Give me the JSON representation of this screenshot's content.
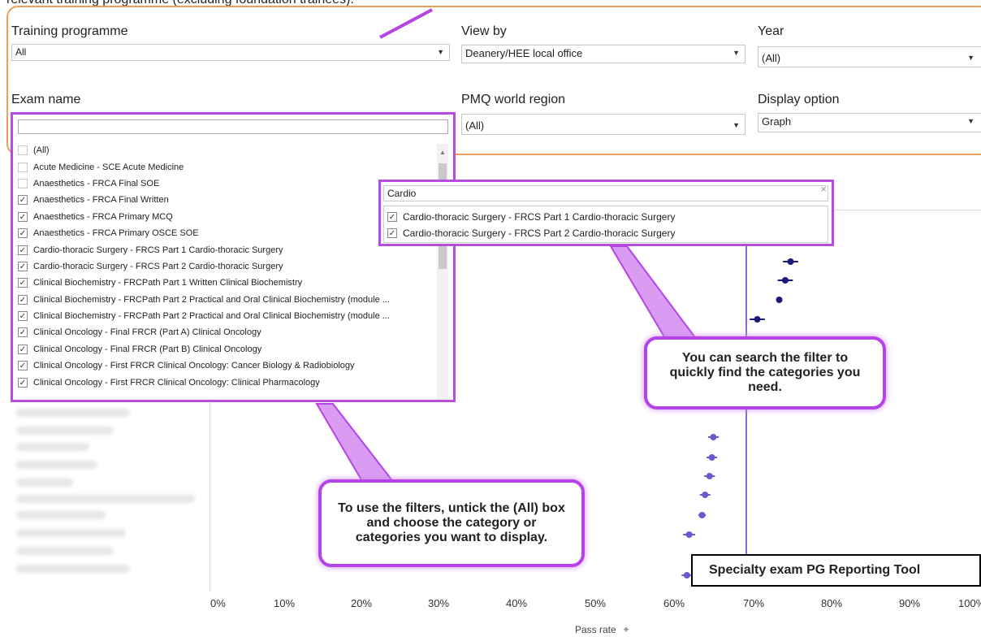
{
  "page": {
    "cut_title": "relevant training programme (excluding foundation trainees)."
  },
  "filters": {
    "training_programme": {
      "label": "Training programme",
      "value": "All"
    },
    "view_by": {
      "label": "View by",
      "value": "Deanery/HEE local office"
    },
    "year": {
      "label": "Year",
      "value": "(All)"
    },
    "exam_name": {
      "label": "Exam name"
    },
    "pmq_region": {
      "label": "PMQ world region",
      "value": "(All)"
    },
    "display_option": {
      "label": "Display option",
      "value": "Graph"
    }
  },
  "exam_dropdown": {
    "options": [
      {
        "label": "(All)",
        "checked": false
      },
      {
        "label": "Acute Medicine - SCE Acute Medicine",
        "checked": false
      },
      {
        "label": "Anaesthetics - FRCA Final SOE",
        "checked": false
      },
      {
        "label": "Anaesthetics - FRCA Final Written",
        "checked": true
      },
      {
        "label": "Anaesthetics - FRCA Primary MCQ",
        "checked": true
      },
      {
        "label": "Anaesthetics - FRCA Primary OSCE SOE",
        "checked": true
      },
      {
        "label": "Cardio-thoracic Surgery - FRCS Part 1 Cardio-thoracic Surgery",
        "checked": true
      },
      {
        "label": "Cardio-thoracic Surgery - FRCS Part 2 Cardio-thoracic Surgery",
        "checked": true
      },
      {
        "label": "Clinical Biochemistry - FRCPath Part 1 Written Clinical Biochemistry",
        "checked": true
      },
      {
        "label": "Clinical Biochemistry - FRCPath Part 2 Practical and Oral Clinical Biochemistry (module ...",
        "checked": true
      },
      {
        "label": "Clinical Biochemistry - FRCPath Part 2 Practical and Oral Clinical Biochemistry (module ...",
        "checked": true
      },
      {
        "label": "Clinical Oncology - Final FRCR (Part A) Clinical Oncology",
        "checked": true
      },
      {
        "label": "Clinical Oncology - Final FRCR (Part B) Clinical Oncology",
        "checked": true
      },
      {
        "label": "Clinical Oncology - First FRCR Clinical Oncology: Cancer Biology & Radiobiology",
        "checked": true
      },
      {
        "label": "Clinical Oncology - First FRCR Clinical Oncology: Clinical Pharmacology",
        "checked": true
      }
    ]
  },
  "cardio_filter": {
    "search_value": "Cardio",
    "close_icon": "×",
    "options": [
      {
        "label": "Cardio-thoracic Surgery - FRCS Part 1 Cardio-thoracic Surgery",
        "checked": true
      },
      {
        "label": "Cardio-thoracic Surgery - FRCS Part 2 Cardio-thoracic Surgery",
        "checked": true
      }
    ]
  },
  "callouts": {
    "search_tip": "You can search the filter to quickly find the categories you need.",
    "filter_tip": "To use the filters, untick the (All) box and choose the category or categories you want to display."
  },
  "brand": "Specialty exam PG Reporting Tool",
  "chart_data": {
    "type": "scatter",
    "xlabel": "Pass rate",
    "xlim": [
      0,
      100
    ],
    "x_ticks": [
      "0%",
      "10%",
      "20%",
      "30%",
      "40%",
      "50%",
      "60%",
      "70%",
      "80%",
      "90%",
      "100%"
    ],
    "reference_line_x": 66,
    "colors": {
      "dark": "#1a1a7a",
      "light": "#6a5acd",
      "ref": "#8d6bd1"
    },
    "series": [
      {
        "values": [
          {
            "x": 75.7,
            "err": 1.0
          },
          {
            "x": 75.0,
            "err": 1.0
          },
          {
            "x": 74.2,
            "err": 0.3
          },
          {
            "x": 71.3,
            "err": 1.0
          }
        ]
      },
      {
        "values": [
          {
            "x": 65.5,
            "err": 0.7
          },
          {
            "x": 65.3,
            "err": 0.7
          },
          {
            "x": 65.0,
            "err": 0.7
          },
          {
            "x": 64.4,
            "err": 0.7
          },
          {
            "x": 64.0,
            "err": 0.5
          },
          {
            "x": 62.3,
            "err": 0.8
          },
          {
            "x": 62.0,
            "err": 0.7
          }
        ]
      }
    ]
  }
}
